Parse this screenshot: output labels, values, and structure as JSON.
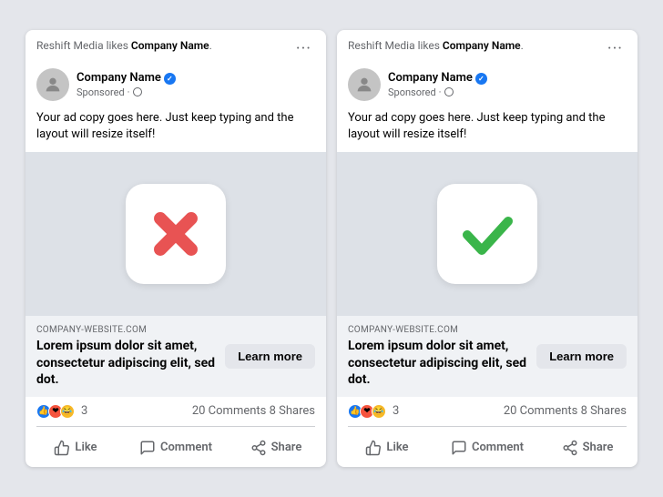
{
  "cards": [
    {
      "id": "card-x",
      "likes_text_prefix": "Reshift Media likes ",
      "likes_text_company": "Company Name",
      "dots": "···",
      "company_name": "Company Name",
      "sponsored": "Sponsored",
      "ad_copy": "Your ad copy goes here. Just keep typing and the layout will resize itself!",
      "icon_type": "x",
      "website_url": "COMPANY-WEBSITE.COM",
      "headline": "Lorem ipsum dolor sit amet, consectetur adipiscing elit, sed dot.",
      "learn_more": "Learn more",
      "reaction_count": "3",
      "comments_shares": "20 Comments  8 Shares",
      "action_like": "Like",
      "action_comment": "Comment",
      "action_share": "Share"
    },
    {
      "id": "card-check",
      "likes_text_prefix": "Reshift Media likes ",
      "likes_text_company": "Company Name",
      "dots": "···",
      "company_name": "Company Name",
      "sponsored": "Sponsored",
      "ad_copy": "Your ad copy goes here. Just keep typing and the layout will resize itself!",
      "icon_type": "check",
      "website_url": "COMPANY-WEBSITE.COM",
      "headline": "Lorem ipsum dolor sit amet, consectetur adipiscing elit, sed dot.",
      "learn_more": "Learn more",
      "reaction_count": "3",
      "comments_shares": "20 Comments  8 Shares",
      "action_like": "Like",
      "action_comment": "Comment",
      "action_share": "Share"
    }
  ]
}
